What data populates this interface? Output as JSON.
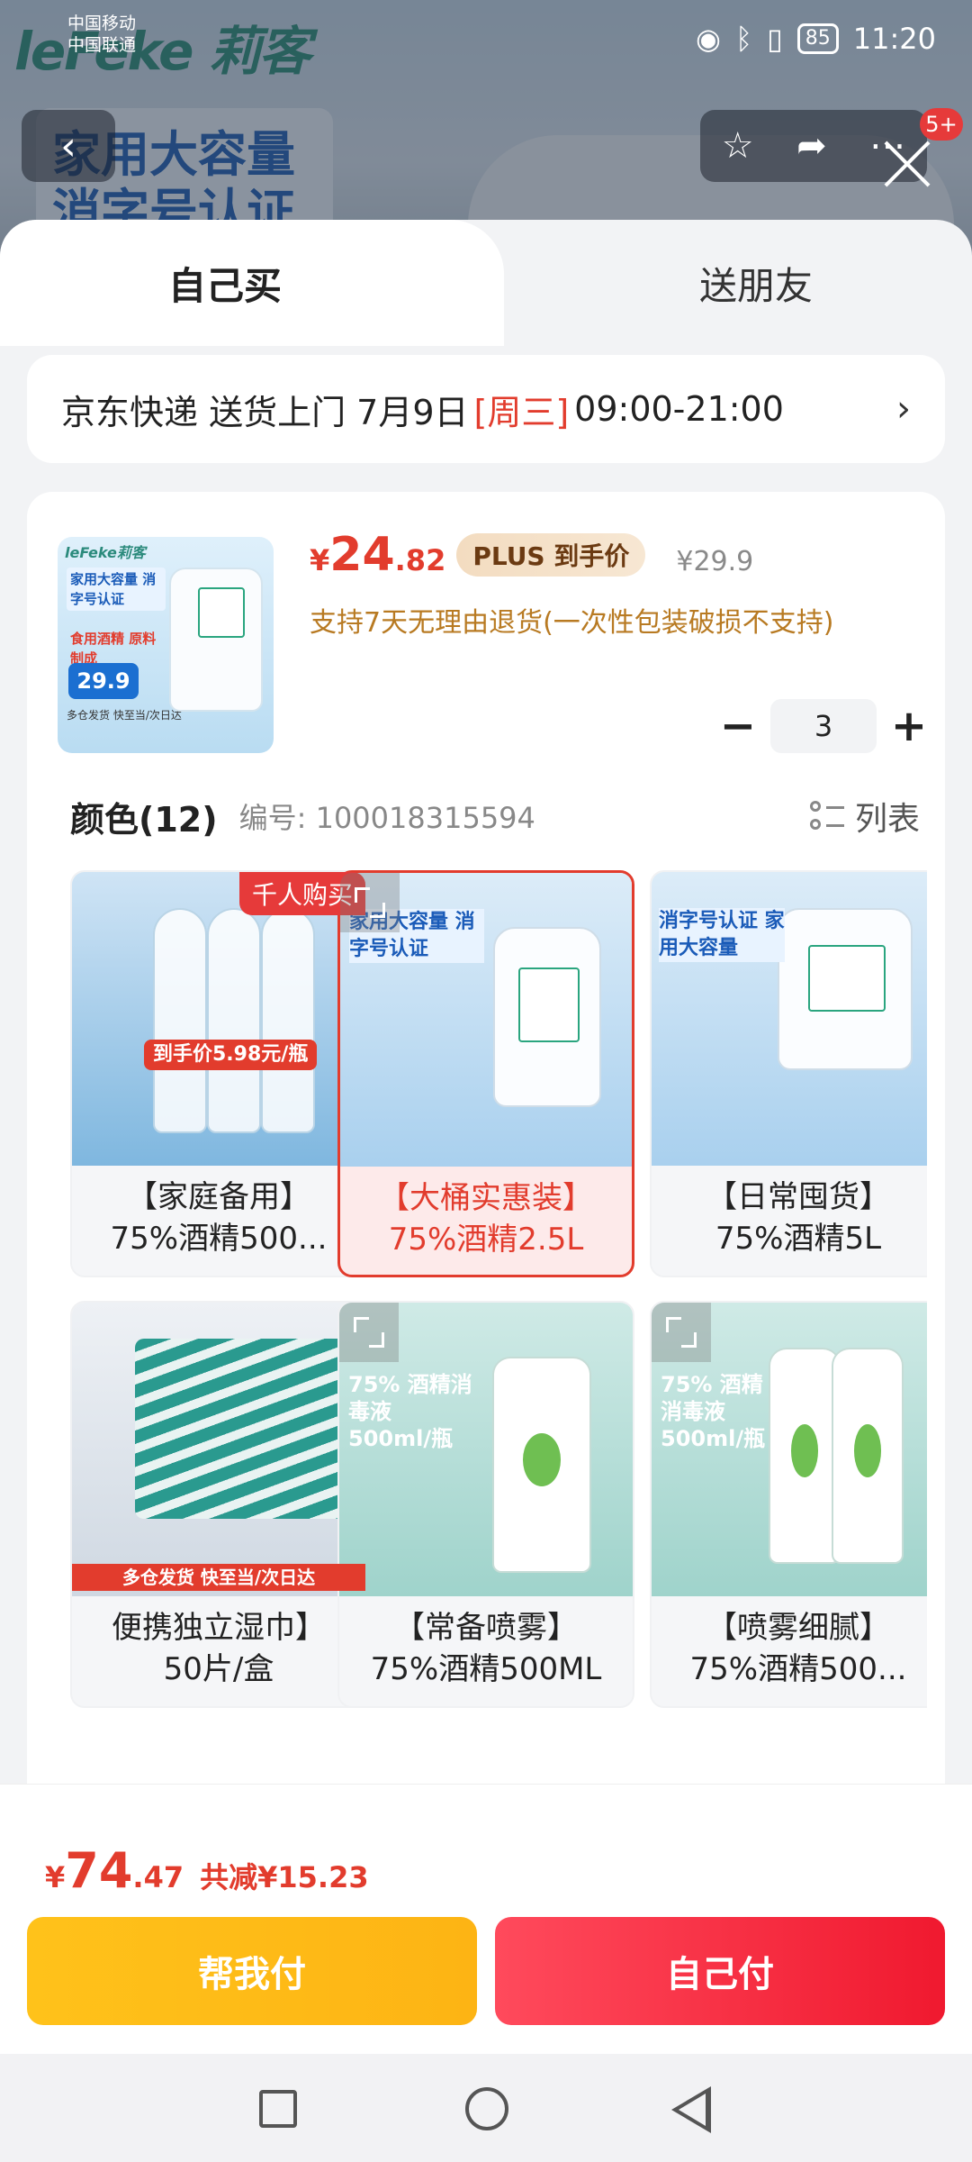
{
  "status_bar": {
    "carrier_1": "中国移动",
    "carrier_2": "中国联通",
    "battery": "85",
    "time": "11:20"
  },
  "background_page": {
    "brand": "leFeke 莉客",
    "headline_1": "家用大容量",
    "headline_2": "消字号认证",
    "cart_badge": "5+"
  },
  "tabs": {
    "buy_self": "自己买",
    "gift_friend": "送朋友"
  },
  "delivery": {
    "prefix": "京东快递 送货上门 7月9日",
    "weekday": "[周三]",
    "window": "09:00-21:00"
  },
  "product": {
    "thumb_logo": "leFeke莉客",
    "thumb_head": "家用大容量 消字号认证",
    "thumb_red": "食用酒精 原料制成",
    "thumb_price": "29.9",
    "thumb_foot": "多仓发货 快至当/次日达",
    "price_currency": "¥",
    "price_int": "24",
    "price_dec": ".82",
    "plus_label": "PLUS 到手价",
    "original_price": "¥29.9",
    "return_policy": "支持7天无理由退货(一次性包装破损不支持)",
    "quantity": "3"
  },
  "variants_section": {
    "title": "颜色(12)",
    "code": "编号: 100018315594",
    "view_toggle": "列表"
  },
  "variants": [
    {
      "line1": "【家庭备用】",
      "line2": "75%酒精500...",
      "badge": "千人购买",
      "img_text": "到手价5.98元/瓶"
    },
    {
      "line1": "【大桶实惠装】",
      "line2": "75%酒精2.5L",
      "img_text": "家用大容量 消字号认证"
    },
    {
      "line1": "【日常囤货】",
      "line2": "75%酒精5L",
      "img_text": "消字号认证 家用大容量"
    },
    {
      "line1": "便携独立湿巾】",
      "line2": "50片/盒",
      "img_text": "多仓发货 快至当/次日达"
    },
    {
      "line1": "【常备喷雾】",
      "line2": "75%酒精500ML",
      "img_text": "75% 酒精消毒液 500ml/瓶"
    },
    {
      "line1": "【喷雾细腻】",
      "line2": "75%酒精500...",
      "img_text": "75% 酒精消毒液 500ml/瓶"
    }
  ],
  "total": {
    "currency": "¥",
    "int": "74",
    "dec": ".47",
    "saving": "共减¥15.23"
  },
  "actions": {
    "friend_pay": "帮我付",
    "self_pay": "自己付"
  },
  "colors": {
    "accent_red": "#e23c2d",
    "friend_pay_yellow": "#fdb414",
    "self_pay_red": "#f0192f"
  }
}
